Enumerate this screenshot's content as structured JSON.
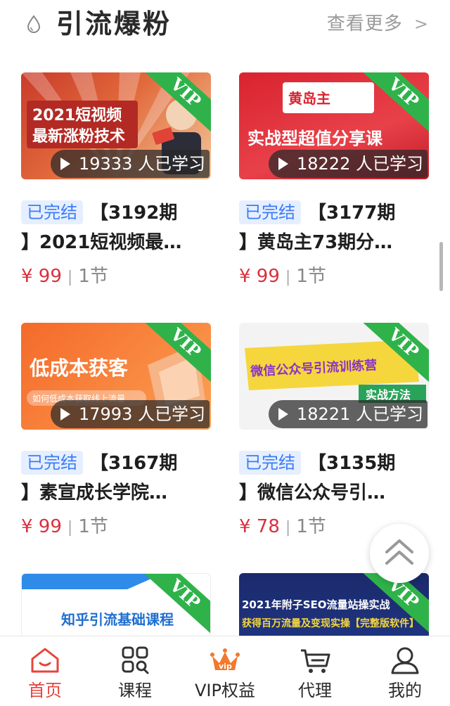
{
  "header": {
    "title": "引流爆粉",
    "more_label": "查看更多"
  },
  "courses": [
    {
      "badge": "已完结",
      "title_line1": "【3192期",
      "title_line2": "】2021短视频最…",
      "learners": "19333 人已学习",
      "price": "¥ 99",
      "lessons": "1节",
      "vip": "VIP",
      "thumb_text": [
        "2021短视频",
        "最新涨粉技术"
      ]
    },
    {
      "badge": "已完结",
      "title_line1": "【3177期",
      "title_line2": "】黄岛主73期分…",
      "learners": "18222 人已学习",
      "price": "¥ 99",
      "lessons": "1节",
      "vip": "VIP",
      "thumb_text": [
        "黄岛主",
        "实战型超值分享课"
      ]
    },
    {
      "badge": "已完结",
      "title_line1": "【3167期",
      "title_line2": "】素宣成长学院…",
      "learners": "17993 人已学习",
      "price": "¥ 99",
      "lessons": "1节",
      "vip": "VIP",
      "thumb_text": [
        "低成本获客",
        "如何低成本获取线上流量"
      ]
    },
    {
      "badge": "已完结",
      "title_line1": "【3135期",
      "title_line2": "】微信公众号引…",
      "learners": "18221 人已学习",
      "price": "¥ 78",
      "lessons": "1节",
      "vip": "VIP",
      "thumb_text": [
        "微信公众号引流训练营",
        "实战方法"
      ]
    },
    {
      "vip": "VIP",
      "thumb_text": [
        "知乎引流基础课程"
      ]
    },
    {
      "vip": "VIP",
      "thumb_text": [
        "2021年附子SEO流量站操实战",
        "获得百万流量及变现实操【完整版软件】"
      ]
    }
  ],
  "tabs": [
    {
      "label": "首页",
      "icon": "home-icon"
    },
    {
      "label": "课程",
      "icon": "grid-icon"
    },
    {
      "label": "VIP权益",
      "icon": "vip-crown-icon"
    },
    {
      "label": "代理",
      "icon": "cart-icon"
    },
    {
      "label": "我的",
      "icon": "user-icon"
    }
  ],
  "colors": {
    "accent": "#e8433c",
    "price": "#d8313e",
    "badge_text": "#3c7cf5",
    "badge_bg": "#e6efff",
    "vip_green": "#2fb24a"
  }
}
